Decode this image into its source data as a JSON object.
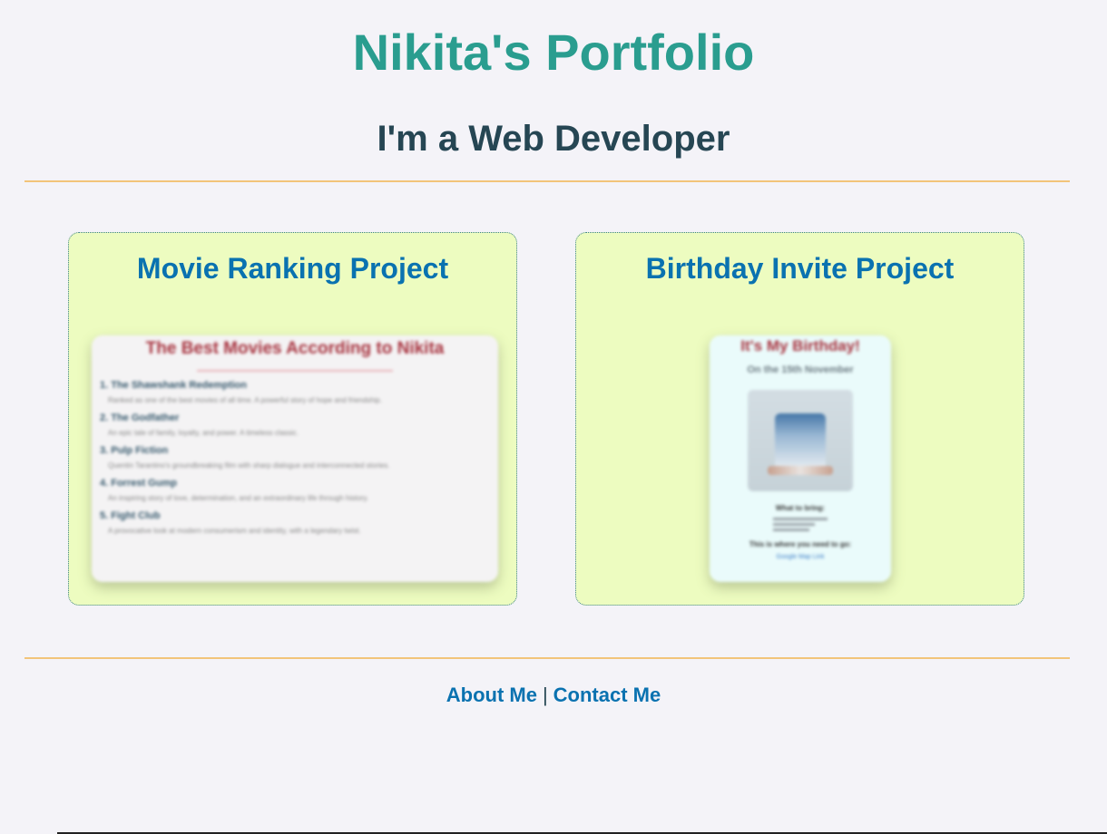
{
  "header": {
    "title": "Nikita's Portfolio",
    "subtitle": "I'm a Web Developer"
  },
  "projects": [
    {
      "title": "Movie Ranking Project",
      "preview": {
        "heading": "The Best Movies According to Nikita",
        "items": [
          {
            "title": "1. The Shawshank Redemption",
            "desc": "Ranked as one of the best movies of all time. A powerful story of hope and friendship."
          },
          {
            "title": "2. The Godfather",
            "desc": "An epic tale of family, loyalty, and power. A timeless classic."
          },
          {
            "title": "3. Pulp Fiction",
            "desc": "Quentin Tarantino's groundbreaking film with sharp dialogue and interconnected stories."
          },
          {
            "title": "4. Forrest Gump",
            "desc": "An inspiring story of love, determination, and an extraordinary life through history."
          },
          {
            "title": "5. Fight Club",
            "desc": "A provocative look at modern consumerism and identity, with a legendary twist."
          }
        ]
      }
    },
    {
      "title": "Birthday Invite Project",
      "preview": {
        "heading": "It's My Birthday!",
        "date": "On the 15th November",
        "bring_heading": "What to bring:",
        "location_text": "This is where you need to go:",
        "link_text": "Google Map Link"
      }
    }
  ],
  "footer": {
    "about": "About Me",
    "separator": "|",
    "contact": "Contact Me"
  },
  "colors": {
    "title": "#2a9d8f",
    "subtitle": "#264653",
    "card_bg": "#edfcc0",
    "card_title": "#0a72b0",
    "rule": "#f2c47a",
    "background": "#f4f3f8"
  }
}
